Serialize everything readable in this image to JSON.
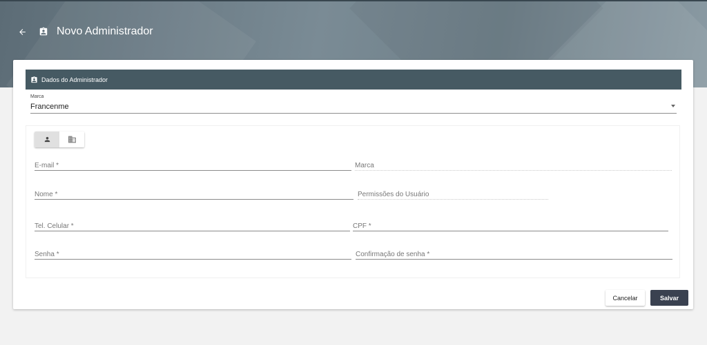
{
  "header": {
    "title": "Novo Administrador",
    "back_icon": "arrow-left-icon",
    "title_icon": "contact-badge-icon"
  },
  "section": {
    "title": "Dados do Administrador",
    "icon": "contact-badge-icon"
  },
  "brand_select": {
    "label": "Marca",
    "value": "Francenme"
  },
  "tabs": [
    {
      "name": "person",
      "icon": "person-icon",
      "active": true
    },
    {
      "name": "company",
      "icon": "building-icon",
      "active": false
    }
  ],
  "form": {
    "email_placeholder": "E-mail *",
    "marca_placeholder": "Marca",
    "nome_placeholder": "Nome *",
    "permissoes_placeholder": "Permissões do Usuário",
    "celular_placeholder": "Tel. Celular *",
    "cpf_placeholder": "CPF *",
    "senha_placeholder": "Senha *",
    "confirmacao_placeholder": "Confirmação de senha *"
  },
  "actions": {
    "cancel_label": "Cancelar",
    "save_label": "Salvar"
  },
  "colors": {
    "header_bg": "#6f8089",
    "section_bg": "#465a63",
    "save_bg": "#3a4150"
  }
}
